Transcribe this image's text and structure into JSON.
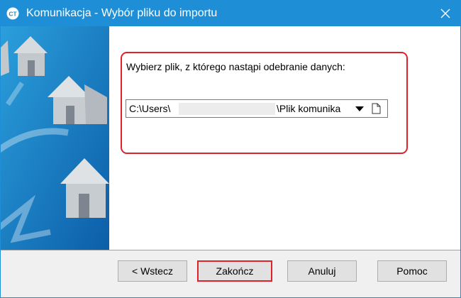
{
  "window": {
    "title": "Komunikacja - Wybór pliku do importu",
    "accent_color": "#1e8fd6",
    "highlight_color": "#e0212b"
  },
  "main": {
    "prompt": "Wybierz plik, z którego nastąpi odebranie danych:",
    "file_path_start": "C:\\Users\\",
    "file_path_end": "\\Plik komunika"
  },
  "buttons": {
    "back": "< Wstecz",
    "finish": "Zakończ",
    "cancel": "Anuluj",
    "help": "Pomoc"
  },
  "icons": [
    "app-icon",
    "close-icon",
    "dropdown-arrow-icon",
    "file-icon",
    "house-icon"
  ]
}
